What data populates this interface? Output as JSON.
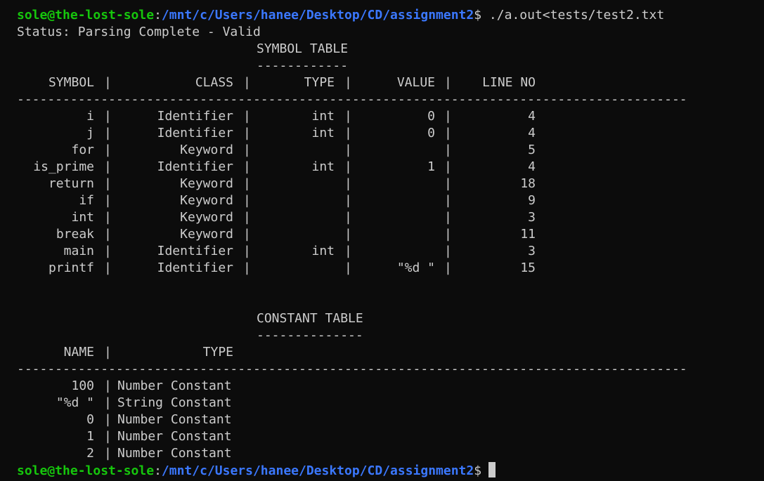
{
  "colors": {
    "background": "#0c0c0c",
    "text": "#cccccc",
    "prompt_user": "#16c60c",
    "prompt_path": "#3b78ff"
  },
  "prompt1": {
    "user_host": "sole@the-lost-sole",
    "sep": ":",
    "path": "/mnt/c/Users/hanee/Desktop/CD/assignment2",
    "symbol": "$",
    "command": " ./a.out<tests/test2.txt"
  },
  "status": "Status: Parsing Complete - Valid",
  "symbol_table": {
    "title": "SYMBOL TABLE",
    "underline": "------------",
    "headers": [
      "SYMBOL",
      "CLASS",
      "TYPE",
      "VALUE",
      "LINE NO"
    ],
    "separator": "----------------------------------------------------------------------------------------",
    "rows": [
      [
        "i",
        "Identifier",
        "int",
        "0",
        "4"
      ],
      [
        "j",
        "Identifier",
        "int",
        "0",
        "4"
      ],
      [
        "for",
        "Keyword",
        "",
        "",
        "5"
      ],
      [
        "is_prime",
        "Identifier",
        "int",
        "1",
        "4"
      ],
      [
        "return",
        "Keyword",
        "",
        "",
        "18"
      ],
      [
        "if",
        "Keyword",
        "",
        "",
        "9"
      ],
      [
        "int",
        "Keyword",
        "",
        "",
        "3"
      ],
      [
        "break",
        "Keyword",
        "",
        "",
        "11"
      ],
      [
        "main",
        "Identifier",
        "int",
        "",
        "3"
      ],
      [
        "printf",
        "Identifier",
        "",
        "\"%d \"",
        "15"
      ]
    ]
  },
  "constant_table": {
    "title": "CONSTANT TABLE",
    "underline": "--------------",
    "headers": [
      "NAME",
      "TYPE"
    ],
    "separator": "----------------------------------------------------------------------------------------",
    "rows": [
      [
        "100",
        "Number Constant"
      ],
      [
        "\"%d \"",
        "String Constant"
      ],
      [
        "0",
        "Number Constant"
      ],
      [
        "1",
        "Number Constant"
      ],
      [
        "2",
        "Number Constant"
      ]
    ]
  },
  "prompt2": {
    "user_host": "sole@the-lost-sole",
    "sep": ":",
    "path": "/mnt/c/Users/hanee/Desktop/CD/assignment2",
    "symbol": "$"
  }
}
